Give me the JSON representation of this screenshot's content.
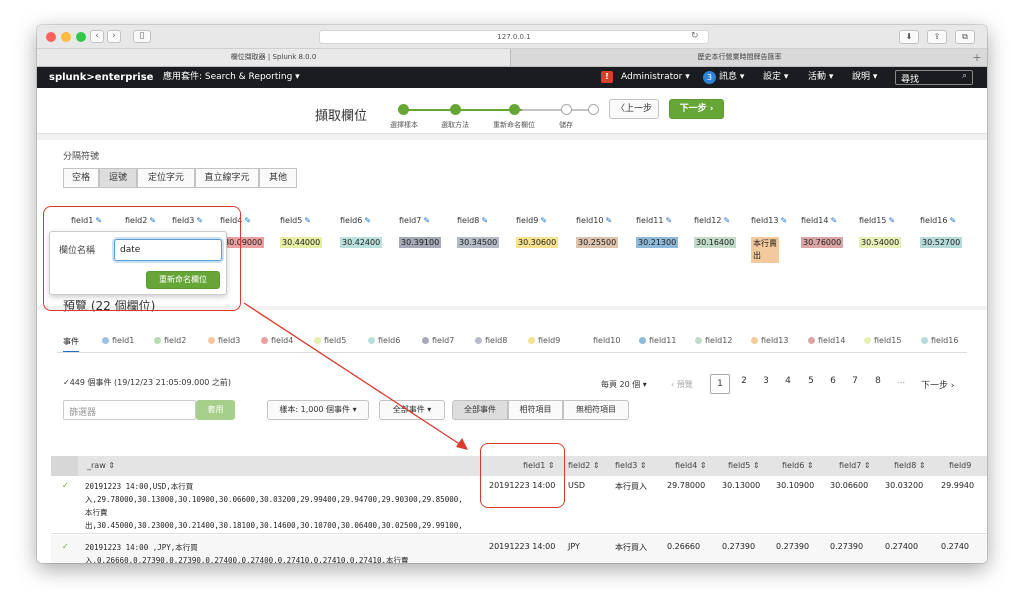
{
  "browser": {
    "url": "127.0.0.1",
    "tabs": [
      "欄位擷取器 | Splunk 8.0.0",
      "歷史本行營業時間牌告匯率"
    ],
    "new_tab_symbol": "+"
  },
  "nav": {
    "logo": "splunk>enterprise",
    "app": "應用套件: Search & Reporting ▾",
    "admin": "Administrator ▾",
    "messages_count": "3",
    "messages": "訊息 ▾",
    "settings": "設定 ▾",
    "activity": "活動 ▾",
    "help": "說明 ▾",
    "search_placeholder": "尋找"
  },
  "wizard": {
    "title": "擷取欄位",
    "steps": [
      "選擇樣本",
      "選取方法",
      "重新命名欄位",
      "儲存"
    ],
    "current_step": 3,
    "back": "〈上一步",
    "next": "下一步 ›"
  },
  "delimiter": {
    "label": "分隔符號",
    "options": [
      "空格",
      "逗號",
      "定位字元",
      "直立線字元",
      "其他"
    ],
    "selected": "逗號"
  },
  "fields": {
    "names": [
      "field1",
      "field2",
      "field3",
      "field4",
      "field5",
      "field6",
      "field7",
      "field8",
      "field9",
      "field10",
      "field11",
      "field12",
      "field13",
      "field14",
      "field15",
      "field16"
    ],
    "sample_values": [
      "",
      "",
      "",
      "30.09000",
      "30.44000",
      "30.42400",
      "30.39100",
      "30.34500",
      "30.30600",
      "30.25500",
      "30.21300",
      "30.16400",
      "本行賣出",
      "30.76000",
      "30.54000",
      "30.52700"
    ],
    "colors": [
      "#9bc2e6",
      "#b7dcb0",
      "#f7c59f",
      "#e8a0a0",
      "#e6eda5",
      "#b9e0dc",
      "#a6a9b7",
      "#b5bcc7",
      "#f8e28f",
      "#dcc3ad",
      "#8fb9d8",
      "#c2dcc9",
      "#f3c99e",
      "#d9a5a5",
      "#e8efb6",
      "#b5dad8"
    ]
  },
  "rename_popup": {
    "label": "欄位名稱",
    "value": "date",
    "button": "重新命名欄位"
  },
  "preview": {
    "title": "預覽 (22 個欄位)",
    "tab_events": "事件",
    "event_count": "✓449 個事件 (19/12/23 21:05:09.000 之前)",
    "filter_placeholder": "篩選器",
    "apply": "套用",
    "sample_select": "樣本: 1,000 個事件 ▾",
    "all_events_select": "全部事件 ▾",
    "match_buttons": [
      "全部事件",
      "相符項目",
      "無相符項目"
    ],
    "per_page": "每頁 20 個 ▾",
    "prev": "‹ 預覽",
    "pages": [
      "1",
      "2",
      "3",
      "4",
      "5",
      "6",
      "7",
      "8",
      "..."
    ],
    "next": "下一步 ›"
  },
  "table": {
    "headers": [
      "_raw ⇕",
      "field1 ⇕",
      "field2 ⇕",
      "field3 ⇕",
      "field4 ⇕",
      "field5 ⇕",
      "field6 ⇕",
      "field7 ⇕",
      "field8 ⇕",
      "field9"
    ],
    "rows": [
      {
        "check": "✓",
        "raw": [
          "20191223 14:00,USD,本行買",
          "入,29.78000,30.13000,30.10900,30.06600,30.03200,29.99400,29.94700,29.90300,29.85000,",
          "本行賣",
          "出,30.45000,30.23000,30.21400,30.18100,30.14600,30.10700,30.06400,30.02500,29.99100,"
        ],
        "cells": [
          "20191223 14:00",
          "USD",
          "本行買入",
          "29.78000",
          "30.13000",
          "30.10900",
          "30.06600",
          "30.03200",
          "29.9940"
        ]
      },
      {
        "check": "✓",
        "raw": [
          "20191223 14:00 ,JPY,本行買",
          "入,0.26660,0.27390,0.27390,0.27400,0.27400,0.27410,0.27410,0.27410,本行賣"
        ],
        "cells": [
          "20191223 14:00",
          "JPY",
          "本行買入",
          "0.26660",
          "0.27390",
          "0.27390",
          "0.27390",
          "0.27400",
          "0.2740"
        ]
      }
    ]
  }
}
